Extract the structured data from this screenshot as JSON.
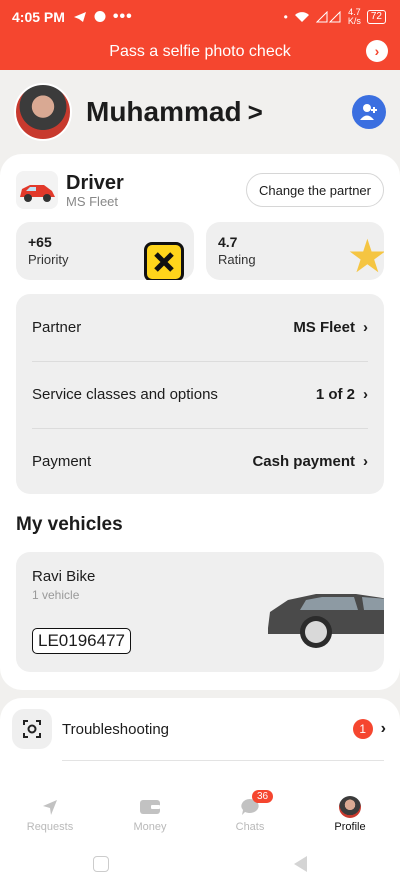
{
  "status_bar": {
    "time": "4:05 PM",
    "dots": "•••",
    "speed_value": "4.7",
    "speed_unit": "K/s",
    "battery": "72"
  },
  "banner": {
    "text": "Pass a selfie photo check",
    "arrow": "›"
  },
  "profile": {
    "name": "Muhammad",
    "chevron": ">"
  },
  "role": {
    "title": "Driver",
    "subtitle": "MS Fleet",
    "change_label": "Change the partner"
  },
  "stats": [
    {
      "value": "+65",
      "label": "Priority"
    },
    {
      "value": "4.7",
      "label": "Rating"
    }
  ],
  "settings": [
    {
      "label": "Partner",
      "value": "MS Fleet"
    },
    {
      "label": "Service classes and options",
      "value": "1 of 2"
    },
    {
      "label": "Payment",
      "value": "Cash payment"
    }
  ],
  "vehicles": {
    "title": "My vehicles",
    "name": "Ravi Bike",
    "count": "1 vehicle",
    "plate": "LE0196477"
  },
  "troubleshooting": {
    "label": "Troubleshooting",
    "badge": "1"
  },
  "tabs": [
    {
      "label": "Requests",
      "icon": "navigation-arrow-icon"
    },
    {
      "label": "Money",
      "icon": "wallet-icon"
    },
    {
      "label": "Chats",
      "icon": "chat-bubble-icon",
      "badge": "36"
    },
    {
      "label": "Profile",
      "icon": "avatar-icon"
    }
  ],
  "colors": {
    "accent": "#f5462f",
    "action_blue": "#3b6fe0",
    "badge_yellow": "#ffd51b"
  }
}
